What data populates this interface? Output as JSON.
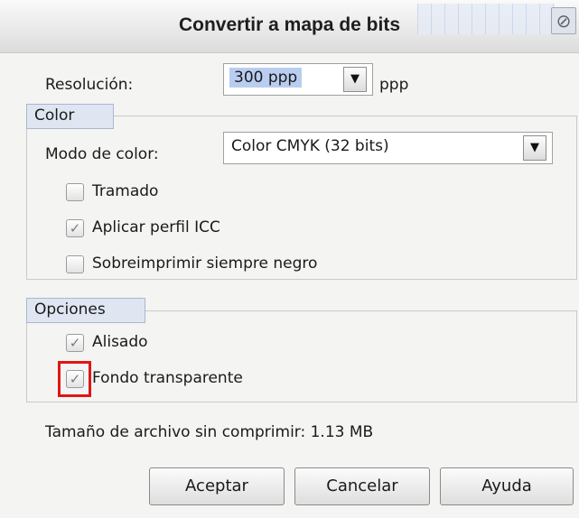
{
  "dialog": {
    "title": "Convertir a mapa de bits",
    "close_icon": "close-icon"
  },
  "resolution": {
    "label": "Resolución:",
    "value": "300 ppp",
    "unit": "ppp"
  },
  "color_group": {
    "title": "Color",
    "mode_label": "Modo de color:",
    "mode_value": "Color CMYK (32 bits)",
    "options": [
      {
        "label": "Tramado",
        "checked": false
      },
      {
        "label": "Aplicar perfil ICC",
        "checked": true
      },
      {
        "label": "Sobreimprimir siempre negro",
        "checked": false
      }
    ]
  },
  "options_group": {
    "title": "Opciones",
    "options": [
      {
        "label": "Alisado",
        "checked": true
      },
      {
        "label": "Fondo transparente",
        "checked": true,
        "highlighted": true
      }
    ]
  },
  "file_size_text": "Tamaño de archivo sin comprimir: 1.13 MB",
  "buttons": {
    "ok": "Aceptar",
    "cancel": "Cancelar",
    "help": "Ayuda"
  },
  "colors": {
    "highlight": "#e01616",
    "group_tab_bg": "#dfe6f2",
    "selection_bg": "#b9cdf0"
  }
}
